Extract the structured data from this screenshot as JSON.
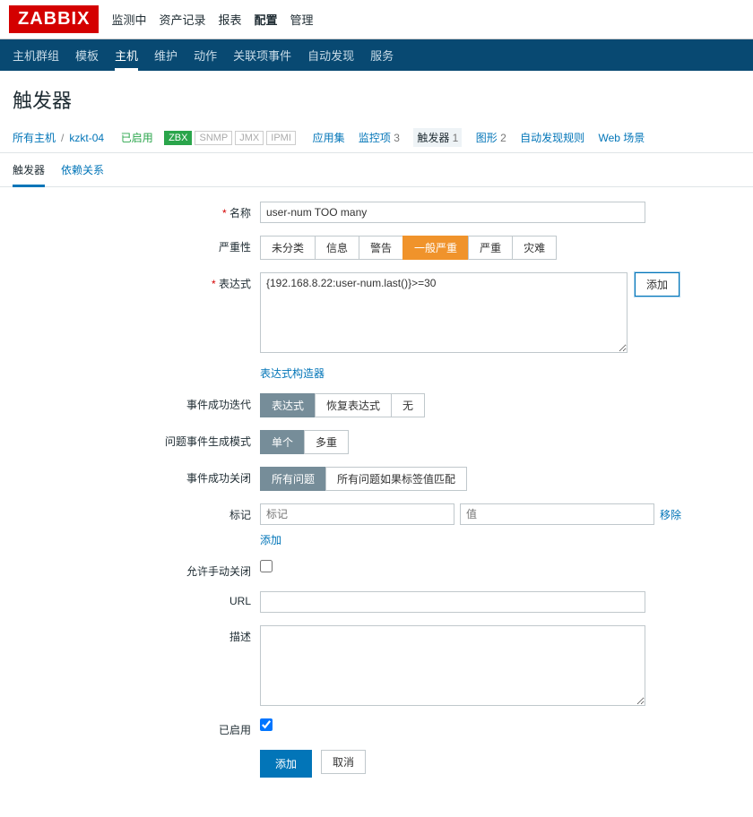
{
  "logo": "ZABBIX",
  "topnav": {
    "items": [
      "监测中",
      "资产记录",
      "报表",
      "配置",
      "管理"
    ],
    "active": 3
  },
  "subnav": {
    "items": [
      "主机群组",
      "模板",
      "主机",
      "维护",
      "动作",
      "关联项事件",
      "自动发现",
      "服务"
    ],
    "active": 2
  },
  "page_title": "触发器",
  "crumb": {
    "all_hosts": "所有主机",
    "host": "kzkt-04",
    "enabled": "已启用",
    "badges": [
      "ZBX",
      "SNMP",
      "JMX",
      "IPMI"
    ],
    "links": [
      {
        "label": "应用集",
        "count": ""
      },
      {
        "label": "监控项",
        "count": "3"
      },
      {
        "label": "触发器",
        "count": "1",
        "current": true
      },
      {
        "label": "图形",
        "count": "2"
      },
      {
        "label": "自动发现规则",
        "count": ""
      },
      {
        "label": "Web 场景",
        "count": ""
      }
    ]
  },
  "tabs": {
    "items": [
      "触发器",
      "依赖关系"
    ],
    "active": 0
  },
  "form": {
    "name": {
      "label": "名称",
      "value": "user-num TOO many"
    },
    "severity": {
      "label": "严重性",
      "options": [
        "未分类",
        "信息",
        "警告",
        "一般严重",
        "严重",
        "灾难"
      ],
      "selected": 3
    },
    "expression": {
      "label": "表达式",
      "value": "{192.168.8.22:user-num.last()}>=30",
      "add": "添加",
      "builder": "表达式构造器"
    },
    "ok_gen": {
      "label": "事件成功迭代",
      "options": [
        "表达式",
        "恢复表达式",
        "无"
      ],
      "selected": 0
    },
    "problem_gen": {
      "label": "问题事件生成模式",
      "options": [
        "单个",
        "多重"
      ],
      "selected": 0
    },
    "ok_close": {
      "label": "事件成功关闭",
      "options": [
        "所有问题",
        "所有问题如果标签值匹配"
      ],
      "selected": 0
    },
    "tags": {
      "label": "标记",
      "tag_ph": "标记",
      "val_ph": "值",
      "remove": "移除",
      "add": "添加"
    },
    "manual_close": {
      "label": "允许手动关闭",
      "checked": false
    },
    "url": {
      "label": "URL",
      "value": ""
    },
    "desc": {
      "label": "描述",
      "value": ""
    },
    "enabled": {
      "label": "已启用",
      "checked": true
    },
    "submit": "添加",
    "cancel": "取消"
  }
}
